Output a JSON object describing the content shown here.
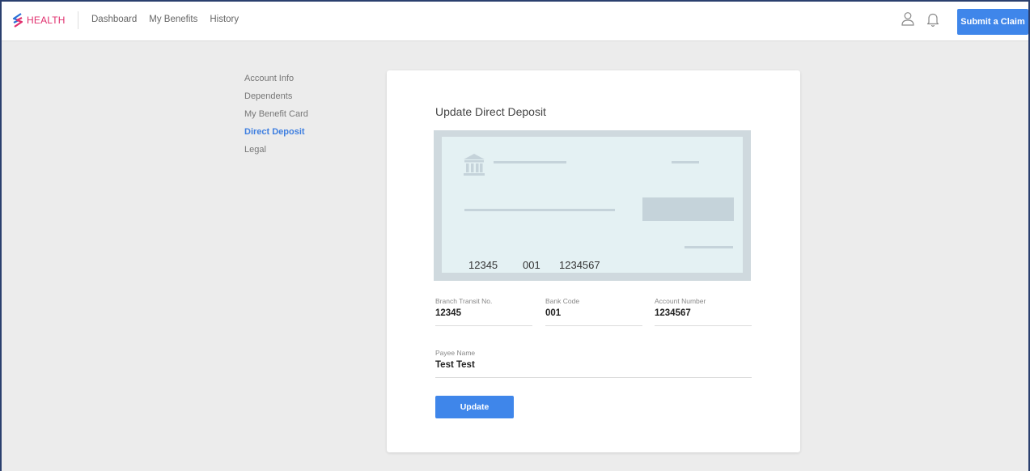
{
  "brand": {
    "name": "HEALTH",
    "color": "#e0306e",
    "icon": "logo-icon"
  },
  "nav": {
    "items": [
      "Dashboard",
      "My Benefits",
      "History"
    ]
  },
  "header": {
    "submit_label": "Submit a Claim",
    "accent": "#3f86ea"
  },
  "sidebar": {
    "items": [
      {
        "label": "Account Info",
        "active": false
      },
      {
        "label": "Dependents",
        "active": false
      },
      {
        "label": "My Benefit Card",
        "active": false
      },
      {
        "label": "Direct Deposit",
        "active": true
      },
      {
        "label": "Legal",
        "active": false
      }
    ]
  },
  "main": {
    "title": "Update Direct Deposit",
    "cheque": {
      "transit": "12345",
      "bank": "001",
      "account": "1234567"
    },
    "fields": {
      "transit": {
        "label": "Branch Transit No.",
        "value": "12345"
      },
      "bank_code": {
        "label": "Bank Code",
        "value": "001"
      },
      "account": {
        "label": "Account Number",
        "value": "1234567"
      },
      "payee": {
        "label": "Payee Name",
        "value": "Test Test"
      }
    },
    "update_label": "Update"
  }
}
